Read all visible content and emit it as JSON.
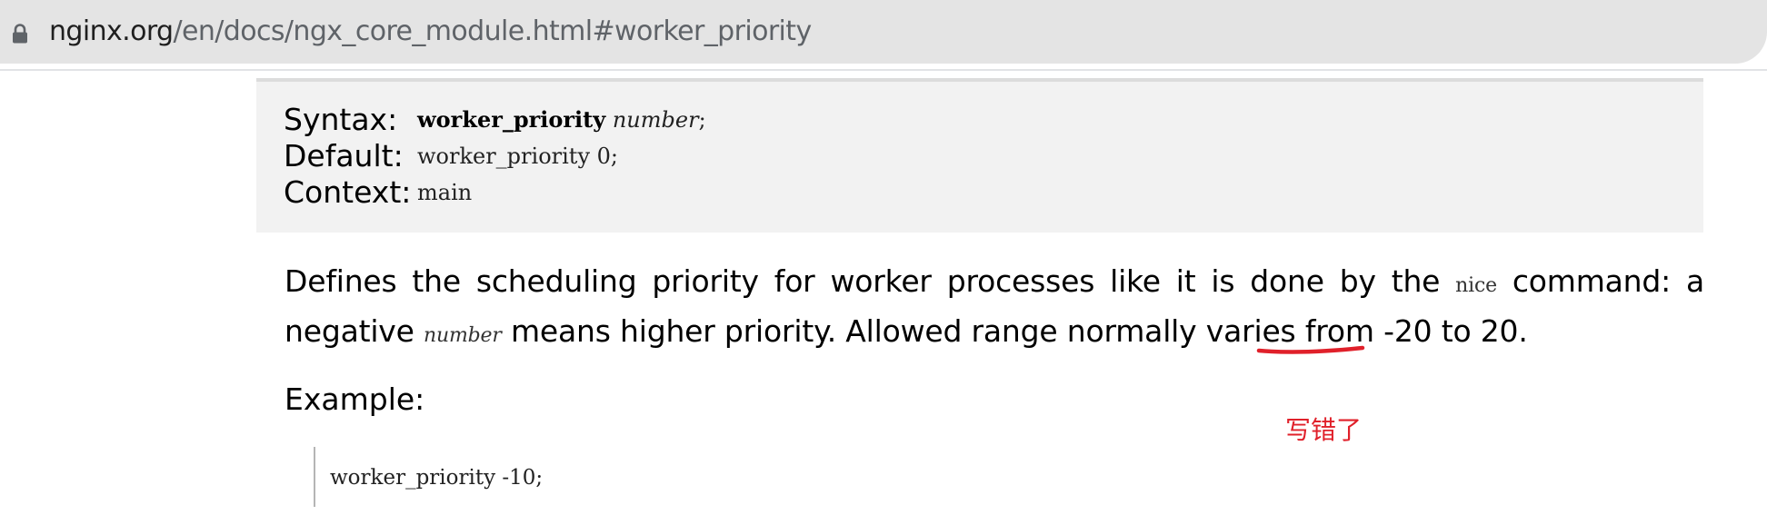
{
  "browser": {
    "url_host": "nginx.org",
    "url_path": "/en/docs/ngx_core_module.html#worker_priority",
    "lock_icon": "lock-icon"
  },
  "directive": {
    "syntax_label": "Syntax:",
    "syntax_name": "worker_priority",
    "syntax_param": "number",
    "syntax_end": ";",
    "default_label": "Default:",
    "default_value": "worker_priority 0;",
    "context_label": "Context:",
    "context_value": "main"
  },
  "description": {
    "text_1": "Defines the scheduling priority for worker processes like it is done by the ",
    "code_nice": "nice",
    "text_2": " command: a negative ",
    "param_number": "number",
    "text_3": " means higher priority. Allowed range normally varies from -20 to 20."
  },
  "example": {
    "heading": "Example:",
    "code": "worker_priority -10;"
  },
  "annotation": {
    "note": "写错了",
    "color": "#e0202a"
  }
}
